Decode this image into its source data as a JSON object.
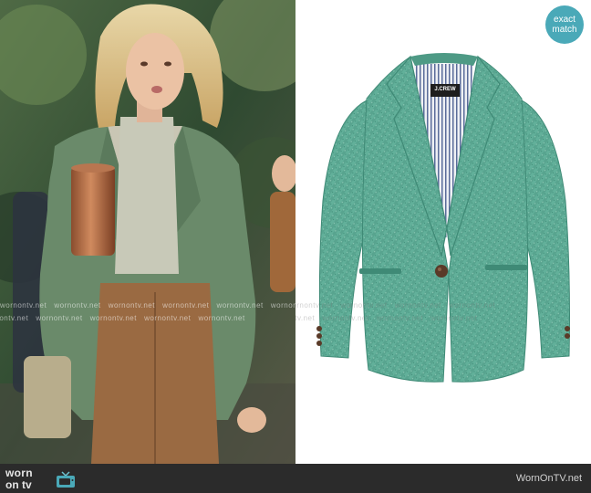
{
  "badge": {
    "line1": "exact",
    "line2": "match"
  },
  "watermark": {
    "text": "wornontv.net"
  },
  "blazer_label": {
    "text": "J.CREW"
  },
  "footer": {
    "logo_line1": "worn",
    "logo_line2": "on tv",
    "site_name": "WornOnTV.net"
  },
  "colors": {
    "badge": "#4aa9b8",
    "footer": "#2b2b2b",
    "blazer_teal": "#62b09a",
    "blazer_shadow": "#3f8a76",
    "scene_green": "#3d5a3a"
  }
}
